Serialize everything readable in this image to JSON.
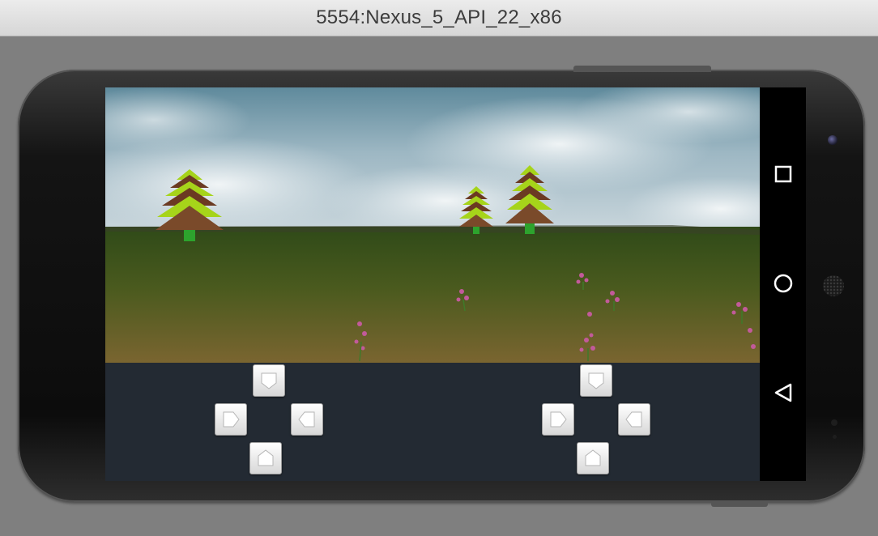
{
  "window": {
    "title": "5554:Nexus_5_API_22_x86"
  },
  "device": {
    "model": "Nexus 5",
    "orientation": "landscape"
  },
  "game": {
    "scene": "3D terrain with trees and flowers",
    "colors": {
      "sky": "#8fb0c0",
      "grass": "#3d5a20",
      "dirt": "#6e5a28",
      "tree_green": "#9acc1a",
      "tree_brown": "#6b3a22"
    }
  },
  "controls": {
    "left_pad": {
      "up_icon": "arrow-down-icon",
      "left_icon": "arrow-right-icon",
      "right_icon": "arrow-left-icon",
      "down_icon": "arrow-up-icon"
    },
    "right_pad": {
      "up_icon": "arrow-down-icon",
      "left_icon": "arrow-right-icon",
      "right_icon": "arrow-left-icon",
      "down_icon": "arrow-up-icon"
    }
  },
  "navbar": {
    "icons": [
      "recents-icon",
      "home-icon",
      "back-icon"
    ]
  }
}
